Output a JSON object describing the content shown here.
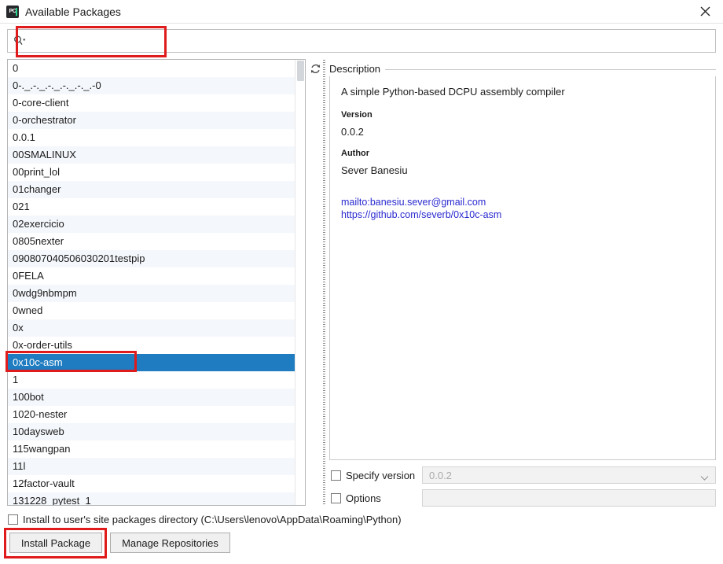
{
  "window": {
    "title": "Available Packages",
    "app_icon": "pycharm-icon",
    "close_label": "✕"
  },
  "search": {
    "icon": "search-icon",
    "value": "",
    "placeholder": ""
  },
  "list": {
    "refresh_icon": "refresh-icon",
    "selected_index": 17,
    "items": [
      "0",
      "0-._.-._.-._.-._.-._.-0",
      "0-core-client",
      "0-orchestrator",
      "0.0.1",
      "00SMALINUX",
      "00print_lol",
      "01changer",
      "021",
      "02exercicio",
      "0805nexter",
      "090807040506030201testpip",
      "0FELA",
      "0wdg9nbmpm",
      "0wned",
      "0x",
      "0x-order-utils",
      "0x10c-asm",
      "1",
      "100bot",
      "1020-nester",
      "10daysweb",
      "115wangpan",
      "11l",
      "12factor-vault",
      "131228_pytest_1"
    ]
  },
  "description": {
    "legend": "Description",
    "summary": "A simple Python-based DCPU assembly compiler",
    "version_label": "Version",
    "version_value": "0.0.2",
    "author_label": "Author",
    "author_value": "Sever Banesiu",
    "links": [
      "mailto:banesiu.sever@gmail.com",
      "https://github.com/severb/0x10c-asm"
    ]
  },
  "options": {
    "specify_version_label": "Specify version",
    "specify_version_checked": false,
    "version_select_value": "0.0.2",
    "options_label": "Options",
    "options_checked": false,
    "options_value": ""
  },
  "footer": {
    "user_site_label": "Install to user's site packages directory (C:\\Users\\lenovo\\AppData\\Roaming\\Python)",
    "user_site_checked": false,
    "install_button": "Install Package",
    "manage_button": "Manage Repositories"
  },
  "colors": {
    "selection_blue": "#1f7cc0",
    "annotation_red": "#e01b1b",
    "link_blue": "#2a2ad0",
    "row_alt": "#f4f7fb"
  }
}
